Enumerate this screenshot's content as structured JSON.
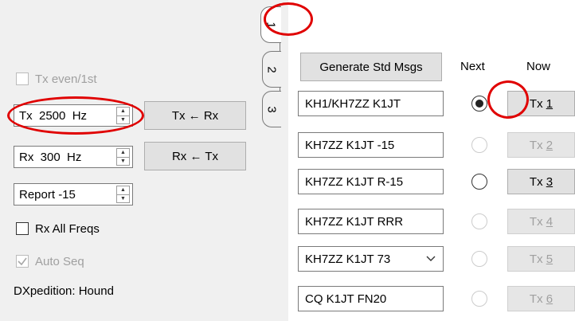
{
  "left_panel": {
    "tx_even": "Tx even/1st",
    "tx_freq": "Tx  2500  Hz",
    "tx_from_rx": "Tx ← Rx",
    "rx_freq": "Rx  300  Hz",
    "rx_from_tx": "Rx ← Tx",
    "report": "Report -15",
    "rx_all_freqs": "Rx All Freqs",
    "auto_seq": "Auto Seq",
    "dxpedition": "DXpedition: Hound"
  },
  "tabs": [
    "1",
    "2",
    "3"
  ],
  "right_panel": {
    "generate_std_msgs": "Generate Std Msgs",
    "next_label": "Next",
    "now_label": "Now",
    "messages": [
      {
        "text": "KH1/KH7ZZ K1JT",
        "tx_prefix": "Tx ",
        "tx_num": "1"
      },
      {
        "text": "KH7ZZ K1JT -15",
        "tx_prefix": "Tx ",
        "tx_num": "2"
      },
      {
        "text": "KH7ZZ K1JT R-15",
        "tx_prefix": "Tx ",
        "tx_num": "3"
      },
      {
        "text": "KH7ZZ K1JT RRR",
        "tx_prefix": "Tx ",
        "tx_num": "4"
      },
      {
        "text": "KH7ZZ K1JT 73",
        "tx_prefix": "Tx ",
        "tx_num": "5"
      },
      {
        "text": "CQ K1JT FN20",
        "tx_prefix": "Tx ",
        "tx_num": "6"
      }
    ]
  },
  "colors": {
    "annotation_ring": "#e00000"
  }
}
